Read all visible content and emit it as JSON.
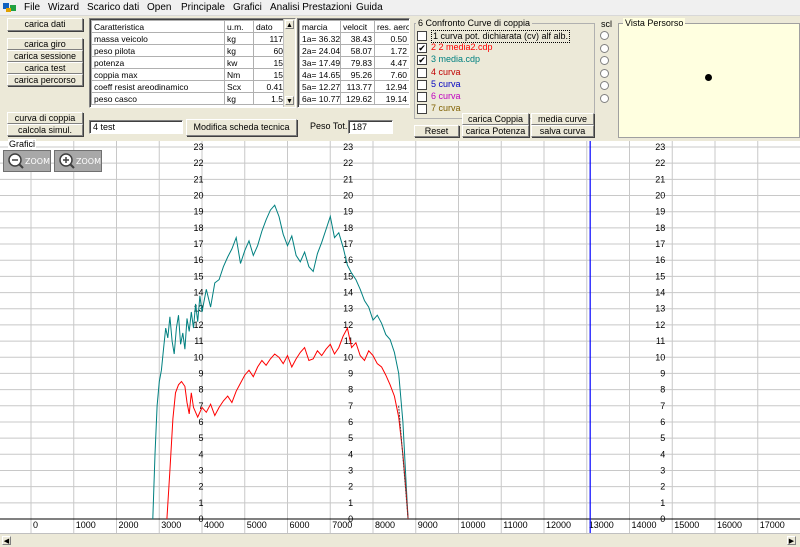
{
  "menu": [
    "File",
    "Wizard",
    "Scarico dati",
    "Open",
    "Principale",
    "Grafici",
    "Analisi Prestazioni",
    "Guida"
  ],
  "left_buttons": {
    "carica_dati": "carica dati",
    "carica_giro": "carica giro",
    "carica_sessione": "carica sessione",
    "carica_test": "carica test",
    "carica_percorso": "carica percorso",
    "curva_di_coppia": "curva di coppia",
    "calcola_simul": "calcola simul."
  },
  "specs_table": {
    "headers": [
      "Caratteristica",
      "u.m.",
      "dato"
    ],
    "rows": [
      [
        "massa veicolo",
        "kg",
        "117"
      ],
      [
        "peso pilota",
        "kg",
        "60"
      ],
      [
        "potenza",
        "kw",
        "15"
      ],
      [
        "coppia max",
        "Nm",
        "15"
      ],
      [
        "coeff resist areodinamico",
        "Scx",
        "0.41"
      ],
      [
        "peso casco",
        "kg",
        "1.5"
      ]
    ]
  },
  "gear_table": {
    "headers": [
      "marcia",
      "velocit",
      "res. aero"
    ],
    "rows": [
      [
        "1a= 36.32",
        "38.43",
        "0.50"
      ],
      [
        "2a= 24.04",
        "58.07",
        "1.72"
      ],
      [
        "3a= 17.49",
        "79.83",
        "4.47"
      ],
      [
        "4a= 14.65",
        "95.26",
        "7.60"
      ],
      [
        "5a= 12.27",
        "113.77",
        "12.94"
      ],
      [
        "6a= 10.77",
        "129.62",
        "19.14"
      ]
    ]
  },
  "test_name": "4 test",
  "modifica_button": "Modifica scheda tecnica",
  "peso_tot_label": "Peso Tot.",
  "peso_tot_value": "187",
  "confronto": {
    "title": "6 Confronto Curve di coppia",
    "items": [
      {
        "label": "1 curva pot. dichiarata (cv) alf alb.",
        "checked": false,
        "color": "#000000"
      },
      {
        "label": "2 2 media2.cdp",
        "checked": true,
        "color": "#ff0000"
      },
      {
        "label": "3 media.cdp",
        "checked": true,
        "color": "#008080"
      },
      {
        "label": "4 curva",
        "checked": false,
        "color": "#c00000"
      },
      {
        "label": "5 curva",
        "checked": false,
        "color": "#0000c0"
      },
      {
        "label": "6 curva",
        "checked": false,
        "color": "#c000c0"
      },
      {
        "label": "7 curva",
        "checked": false,
        "color": "#806000"
      }
    ],
    "reset": "Reset",
    "carica_coppia": "carica Coppia",
    "carica_potenza": "carica Potenza",
    "media_curve": "media curve",
    "salva_curva": "salva curva",
    "check_mark": "✔"
  },
  "scl_label": "scl",
  "vista_title": "Vista Persorso",
  "grafici_label": "Grafici",
  "zoom_label": "ZOOM",
  "colors": {
    "teal": "#008080",
    "red": "#ff0000",
    "cursor": "#0000ff",
    "vista_bg": "#ffffe0"
  },
  "chart_data": {
    "type": "line",
    "xlim": [
      0,
      17800
    ],
    "ylim": [
      0,
      23
    ],
    "x_ticks": [
      0,
      1000,
      2000,
      3000,
      4000,
      5000,
      6000,
      7000,
      8000,
      9000,
      10000,
      11000,
      12000,
      13000,
      14000,
      15000,
      16000,
      17000
    ],
    "y_ticks": [
      0,
      1,
      2,
      3,
      4,
      5,
      6,
      7,
      8,
      9,
      10,
      11,
      12,
      13,
      14,
      15,
      16,
      17,
      18,
      19,
      20,
      21,
      22,
      23
    ],
    "grid": true,
    "cursor_x": 13080,
    "series": [
      {
        "color": "#008080",
        "points": [
          [
            2850,
            0
          ],
          [
            2900,
            4
          ],
          [
            2950,
            7
          ],
          [
            3000,
            8.5
          ],
          [
            3050,
            9.2
          ],
          [
            3100,
            10.5
          ],
          [
            3150,
            11.8
          ],
          [
            3200,
            11.2
          ],
          [
            3250,
            12.5
          ],
          [
            3300,
            11
          ],
          [
            3350,
            10.2
          ],
          [
            3400,
            11.8
          ],
          [
            3450,
            12.6
          ],
          [
            3500,
            10.8
          ],
          [
            3550,
            11.5
          ],
          [
            3600,
            10.5
          ],
          [
            3650,
            12.4
          ],
          [
            3700,
            11.6
          ],
          [
            3750,
            12.8
          ],
          [
            3800,
            11.8
          ],
          [
            3850,
            13.3
          ],
          [
            3900,
            12.2
          ],
          [
            3950,
            13.8
          ],
          [
            4000,
            12.8
          ],
          [
            4100,
            14.2
          ],
          [
            4200,
            13.1
          ],
          [
            4300,
            14.6
          ],
          [
            4400,
            14.8
          ],
          [
            4500,
            15.6
          ],
          [
            4600,
            16.2
          ],
          [
            4700,
            16.7
          ],
          [
            4800,
            17.4
          ],
          [
            4900,
            15.8
          ],
          [
            5000,
            16.6
          ],
          [
            5100,
            17.2
          ],
          [
            5200,
            16.3
          ],
          [
            5300,
            16.9
          ],
          [
            5400,
            17.8
          ],
          [
            5500,
            18.5
          ],
          [
            5600,
            19.1
          ],
          [
            5700,
            19.4
          ],
          [
            5800,
            18.7
          ],
          [
            5900,
            17.6
          ],
          [
            6000,
            16.9
          ],
          [
            6100,
            17.5
          ],
          [
            6200,
            16.3
          ],
          [
            6300,
            15.9
          ],
          [
            6400,
            16.5
          ],
          [
            6500,
            15.6
          ],
          [
            6600,
            15.3
          ],
          [
            6700,
            16.4
          ],
          [
            6800,
            17.1
          ],
          [
            6900,
            17.9
          ],
          [
            7000,
            18.7
          ],
          [
            7100,
            17.4
          ],
          [
            7200,
            17.7
          ],
          [
            7300,
            16.8
          ],
          [
            7400,
            15.7
          ],
          [
            7500,
            15.2
          ],
          [
            7600,
            14.8
          ],
          [
            7700,
            14.2
          ],
          [
            7800,
            13.5
          ],
          [
            7900,
            13.1
          ],
          [
            8000,
            12.3
          ],
          [
            8100,
            12.6
          ],
          [
            8200,
            12.1
          ],
          [
            8300,
            11.4
          ],
          [
            8400,
            11.1
          ],
          [
            8500,
            10.3
          ],
          [
            8600,
            9
          ],
          [
            8700,
            6
          ],
          [
            8780,
            2
          ],
          [
            8820,
            0
          ]
        ]
      },
      {
        "color": "#ff0000",
        "points": [
          [
            3180,
            0
          ],
          [
            3250,
            3
          ],
          [
            3320,
            6.2
          ],
          [
            3380,
            7.8
          ],
          [
            3450,
            8.3
          ],
          [
            3520,
            8.5
          ],
          [
            3600,
            8.2
          ],
          [
            3650,
            7.2
          ],
          [
            3700,
            6.5
          ],
          [
            3750,
            7.8
          ],
          [
            3800,
            6.9
          ],
          [
            3900,
            6.3
          ],
          [
            4000,
            6.9
          ],
          [
            4100,
            6.6
          ],
          [
            4200,
            7.1
          ],
          [
            4300,
            6.4
          ],
          [
            4400,
            6.9
          ],
          [
            4500,
            7.3
          ],
          [
            4600,
            7.6
          ],
          [
            4700,
            7.2
          ],
          [
            4800,
            7.9
          ],
          [
            4900,
            8.4
          ],
          [
            5000,
            8.9
          ],
          [
            5100,
            9.2
          ],
          [
            5200,
            8.8
          ],
          [
            5300,
            9.4
          ],
          [
            5400,
            9.8
          ],
          [
            5500,
            9.5
          ],
          [
            5600,
            9.9
          ],
          [
            5700,
            10.2
          ],
          [
            5800,
            10.0
          ],
          [
            5900,
            9.6
          ],
          [
            6000,
            10.1
          ],
          [
            6100,
            9.4
          ],
          [
            6200,
            9.9
          ],
          [
            6300,
            10.3
          ],
          [
            6400,
            10.6
          ],
          [
            6500,
            9.8
          ],
          [
            6600,
            9.9
          ],
          [
            6700,
            10.4
          ],
          [
            6800,
            10.1
          ],
          [
            6900,
            10.5
          ],
          [
            7000,
            10.8
          ],
          [
            7100,
            10.2
          ],
          [
            7200,
            10.6
          ],
          [
            7300,
            11.3
          ],
          [
            7400,
            11.8
          ],
          [
            7500,
            10.6
          ],
          [
            7600,
            10.9
          ],
          [
            7700,
            10.1
          ],
          [
            7800,
            9.8
          ],
          [
            7900,
            10.4
          ],
          [
            8000,
            10.1
          ],
          [
            8100,
            9.6
          ],
          [
            8200,
            9.4
          ],
          [
            8300,
            8.9
          ],
          [
            8400,
            8.3
          ],
          [
            8500,
            7.6
          ],
          [
            8600,
            6.3
          ],
          [
            8700,
            4
          ],
          [
            8780,
            1.5
          ],
          [
            8820,
            0
          ]
        ]
      }
    ]
  }
}
